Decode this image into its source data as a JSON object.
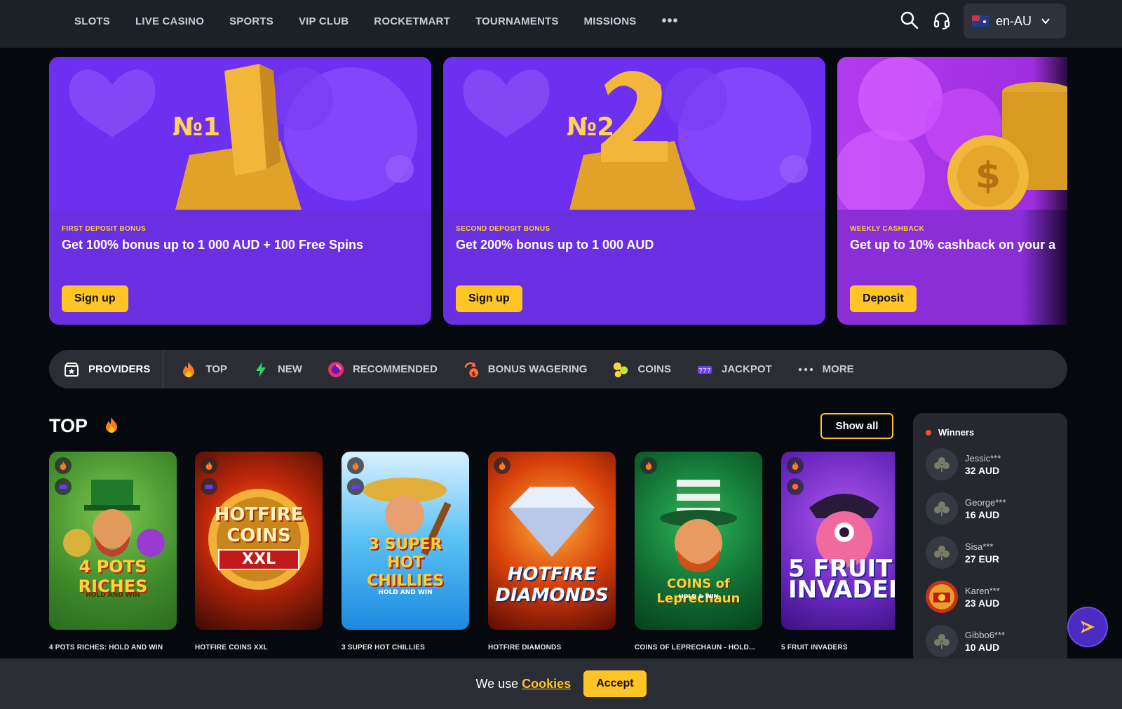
{
  "nav": {
    "items": [
      "SLOTS",
      "LIVE CASINO",
      "SPORTS",
      "VIP CLUB",
      "ROCKETMART",
      "TOURNAMENTS",
      "MISSIONS"
    ],
    "more": "•••",
    "language": "en-AU"
  },
  "promos": [
    {
      "eyebrow": "FIRST DEPOSIT BONUS",
      "headline": "Get 100% bonus up to 1 000 AUD + 100 Free Spins",
      "cta": "Sign up",
      "art_text": "№1"
    },
    {
      "eyebrow": "SECOND DEPOSIT BONUS",
      "headline": "Get 200% bonus up to 1 000 AUD",
      "cta": "Sign up",
      "art_text": "№2"
    },
    {
      "eyebrow": "WEEKLY CASHBACK",
      "headline": "Get up to 10% cashback on your a",
      "cta": "Deposit",
      "art_text": "$"
    }
  ],
  "categories": [
    {
      "label": "PROVIDERS",
      "icon": "providers-icon"
    },
    {
      "label": "TOP",
      "icon": "fire-icon"
    },
    {
      "label": "NEW",
      "icon": "lightning-icon"
    },
    {
      "label": "RECOMMENDED",
      "icon": "recommended-icon"
    },
    {
      "label": "BONUS WAGERING",
      "icon": "bonus-wagering-icon"
    },
    {
      "label": "COINS",
      "icon": "coins-icon"
    },
    {
      "label": "JACKPOT",
      "icon": "jackpot-icon"
    },
    {
      "label": "MORE",
      "icon": "more-icon"
    }
  ],
  "top_section": {
    "title": "TOP",
    "show_all": "Show all",
    "games": [
      {
        "name": "4 POTS RICHES: HOLD AND WIN",
        "art": "4 POTS RICHES",
        "art_sub": "HOLD AND WIN"
      },
      {
        "name": "HOTFIRE COINS XXL",
        "art": "HOTFIRE COINS",
        "art_sub": "XXL"
      },
      {
        "name": "3 SUPER HOT CHILLIES",
        "art": "3 SUPER HOT CHILLIES",
        "art_sub": "HOLD AND WIN"
      },
      {
        "name": "HOTFIRE DIAMONDS",
        "art": "HOTFIRE DIAMONDS",
        "art_sub": ""
      },
      {
        "name": "COINS OF LEPRECHAUN - HOLD...",
        "art": "COINS of Leprechaun",
        "art_sub": "HOLD & WIN"
      },
      {
        "name": "5 FRUIT INVADERS",
        "art": "5 FRUIT INVADERS",
        "art_sub": ""
      }
    ]
  },
  "winners": {
    "title": "Winners",
    "list": [
      {
        "name": "Jessic***",
        "amount": "32 AUD"
      },
      {
        "name": "George***",
        "amount": "16 AUD"
      },
      {
        "name": "Sisa***",
        "amount": "27 EUR"
      },
      {
        "name": "Karen***",
        "amount": "23 AUD"
      },
      {
        "name": "Gibbo6***",
        "amount": "10 AUD"
      }
    ]
  },
  "cookie": {
    "text": "We use",
    "link": "Cookies",
    "accept": "Accept"
  },
  "colors": {
    "accent": "#ffc425",
    "nav_bg": "#1c2027",
    "page_bg": "#05080c",
    "promo_purple": "#6a2fe0"
  }
}
